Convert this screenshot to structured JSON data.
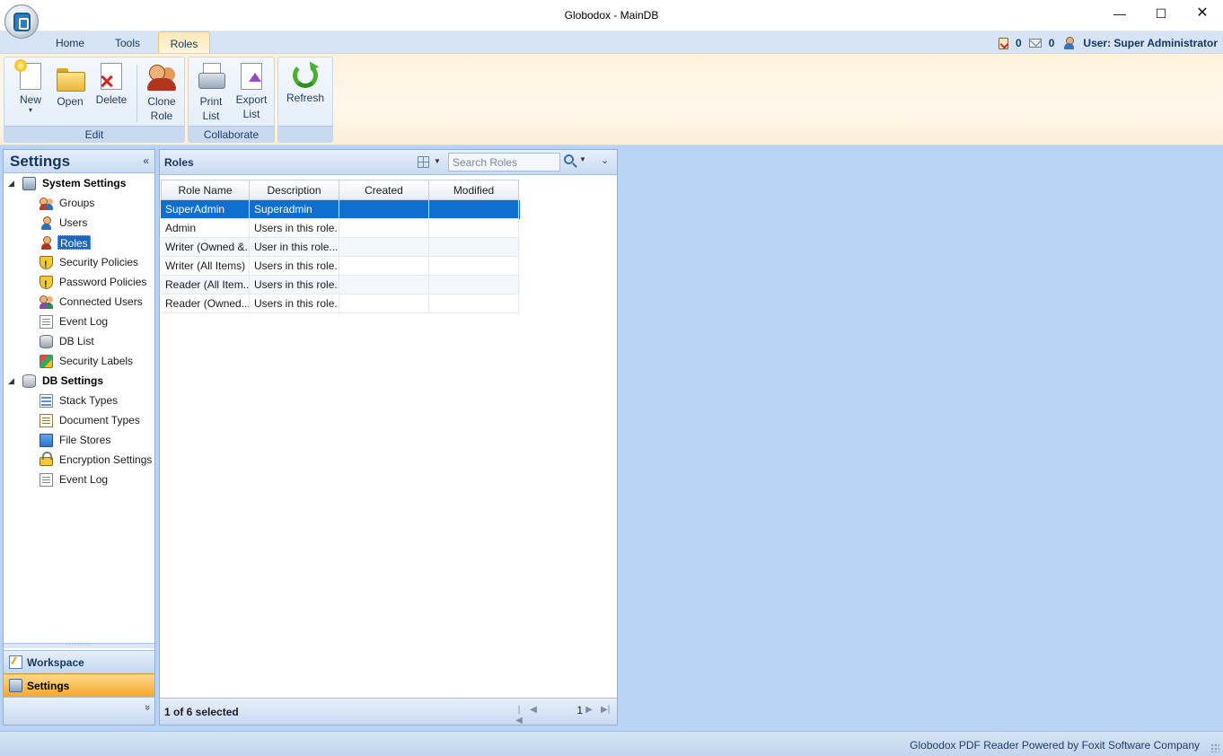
{
  "window": {
    "title": "Globodox - MainDB",
    "controls": {
      "minimize": "—",
      "maximize": "☐",
      "close": "✕"
    }
  },
  "tabs": [
    {
      "label": "Home",
      "active": false
    },
    {
      "label": "Tools",
      "active": false
    },
    {
      "label": "Roles",
      "active": true
    }
  ],
  "status_top": {
    "tasks_count": "0",
    "mail_count": "0",
    "user_label": "User: Super Administrator"
  },
  "ribbon": {
    "groups": {
      "edit": "Edit",
      "collaborate": "Collaborate"
    },
    "buttons": {
      "new": "New",
      "new_caret": "▾",
      "open": "Open",
      "delete": "Delete",
      "clone_role_1": "Clone",
      "clone_role_2": "Role",
      "print_list_1": "Print",
      "print_list_2": "List",
      "export_list_1": "Export",
      "export_list_2": "List",
      "refresh": "Refresh"
    }
  },
  "settings_pane": {
    "title": "Settings",
    "collapse_glyph": "«",
    "tree": [
      {
        "label": "System Settings",
        "icon": "system-settings-icon",
        "category": true
      },
      {
        "label": "Groups",
        "icon": "groups-icon"
      },
      {
        "label": "Users",
        "icon": "users-icon"
      },
      {
        "label": "Roles",
        "icon": "roles-icon",
        "selected": true
      },
      {
        "label": "Security Policies",
        "icon": "security-policies-icon"
      },
      {
        "label": "Password Policies",
        "icon": "password-policies-icon"
      },
      {
        "label": "Connected Users",
        "icon": "connected-users-icon"
      },
      {
        "label": "Event Log",
        "icon": "event-log-icon"
      },
      {
        "label": "DB List",
        "icon": "db-list-icon"
      },
      {
        "label": "Security Labels",
        "icon": "security-labels-icon"
      },
      {
        "label": "DB Settings",
        "icon": "db-settings-icon",
        "category": true
      },
      {
        "label": "Stack Types",
        "icon": "stack-types-icon"
      },
      {
        "label": "Document Types",
        "icon": "document-types-icon"
      },
      {
        "label": "File Stores",
        "icon": "file-stores-icon"
      },
      {
        "label": "Encryption Settings",
        "icon": "encryption-settings-icon"
      },
      {
        "label": "Event Log",
        "icon": "event-log-icon"
      }
    ],
    "expander": "◢",
    "nav": {
      "workspace": "Workspace",
      "settings": "Settings",
      "chevron": "»"
    }
  },
  "roles_pane": {
    "title": "Roles",
    "search_placeholder": "Search Roles",
    "columns": [
      "Role Name",
      "Description",
      "Created",
      "Modified"
    ],
    "rows": [
      {
        "role_name": "SuperAdmin",
        "description": "Superadmin",
        "created": "",
        "modified": "",
        "selected": true
      },
      {
        "role_name": "Admin",
        "description": "Users in this role...",
        "created": "",
        "modified": ""
      },
      {
        "role_name": "Writer (Owned &...",
        "description": "User in this role...",
        "created": "",
        "modified": ""
      },
      {
        "role_name": "Writer (All Items)",
        "description": "Users in this role...",
        "created": "",
        "modified": ""
      },
      {
        "role_name": "Reader (All Item...",
        "description": "Users in this role...",
        "created": "",
        "modified": ""
      },
      {
        "role_name": "Reader (Owned...",
        "description": "Users in this role...",
        "created": "",
        "modified": ""
      }
    ],
    "footer": {
      "selection_text": "1 of 6 selected",
      "page_number": "1",
      "first": "|◀",
      "prev": "◀",
      "next": "▶",
      "last": "▶|"
    }
  },
  "status_bar": {
    "text": "Globodox PDF Reader Powered by Foxit Software Company"
  },
  "colors": {
    "accent": "#0e6fd1",
    "active_tab": "#fbe9b8",
    "workspace_bg": "#b9d3f5",
    "settings_nav": "#f7a82b"
  }
}
